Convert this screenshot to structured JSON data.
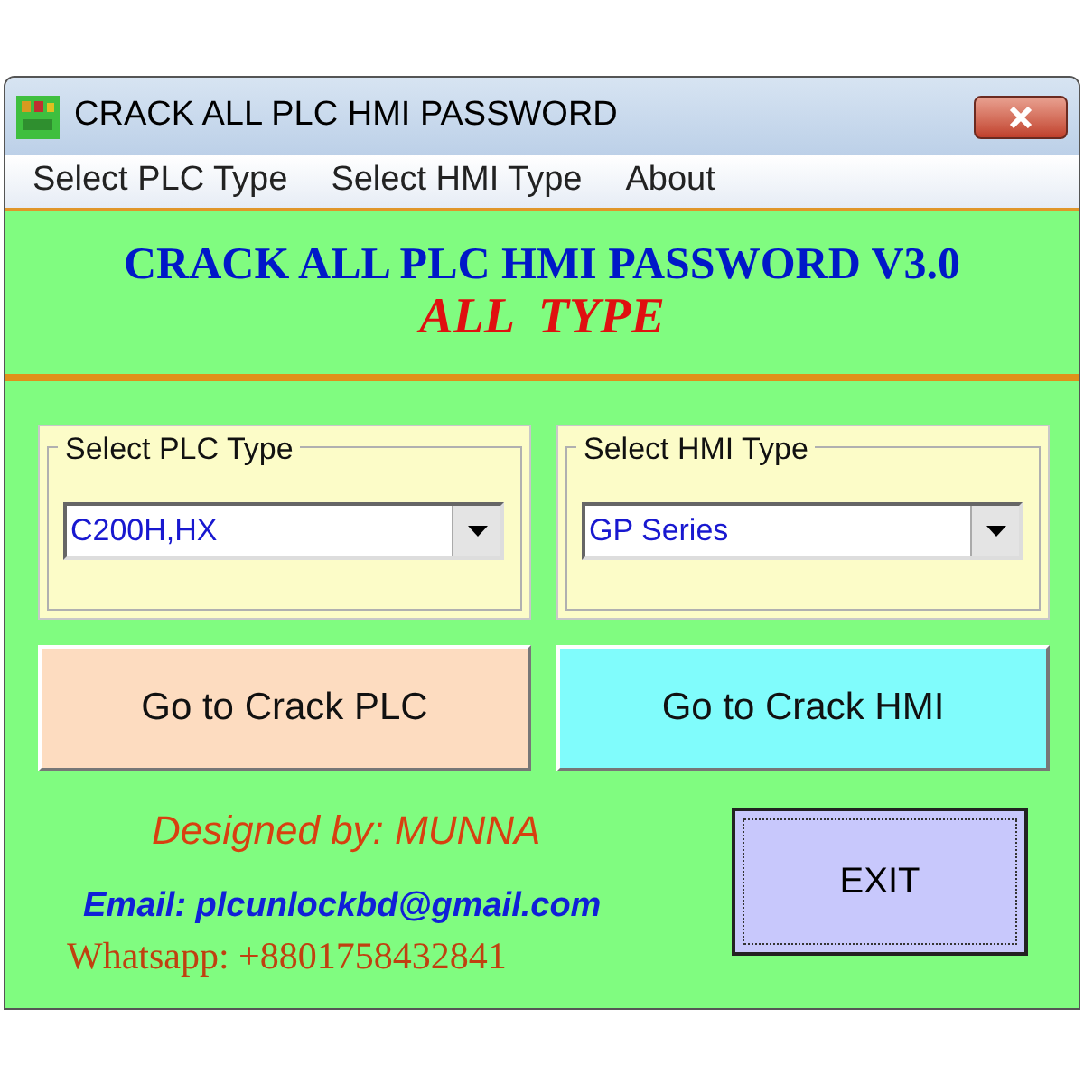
{
  "window": {
    "title": "CRACK ALL PLC HMI PASSWORD"
  },
  "menu": [
    "Select PLC Type",
    "Select HMI Type",
    "About"
  ],
  "header": {
    "title": "CRACK ALL PLC HMI PASSWORD V3.0",
    "subtitle": "ALL  TYPE"
  },
  "groups": [
    {
      "label": "Select PLC Type",
      "value": "C200H,HX"
    },
    {
      "label": "Select HMI Type",
      "value": "GP Series"
    }
  ],
  "actions": [
    {
      "label": "Go to Crack PLC",
      "color": "#fddcc0"
    },
    {
      "label": "Go to Crack HMI",
      "color": "#80fcfc"
    }
  ],
  "credits": {
    "designer": "Designed by: MUNNA",
    "email": "Email: plcunlockbd@gmail.com",
    "whatsapp": "Whatsapp: +8801758432841"
  },
  "exit_button": "EXIT"
}
